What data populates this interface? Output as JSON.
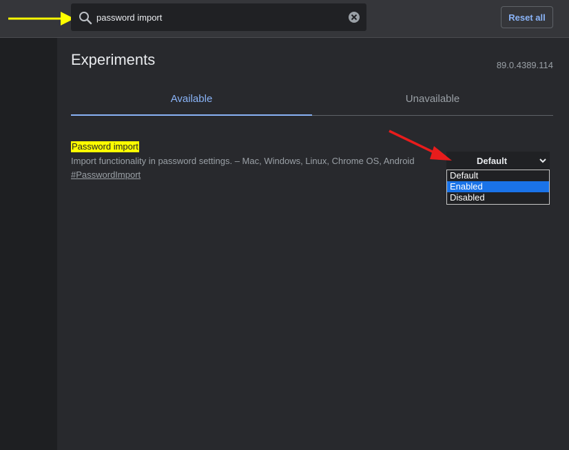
{
  "search": {
    "value": "password import"
  },
  "toolbar": {
    "reset_label": "Reset all"
  },
  "page": {
    "title": "Experiments",
    "version": "89.0.4389.114"
  },
  "tabs": [
    {
      "label": "Available",
      "active": true
    },
    {
      "label": "Unavailable",
      "active": false
    }
  ],
  "experiment": {
    "title": "Password import",
    "description": "Import functionality in password settings. – Mac, Windows, Linux, Chrome OS, Android",
    "link": "#PasswordImport",
    "selected_value": "Default",
    "options": [
      "Default",
      "Enabled",
      "Disabled"
    ],
    "highlighted_option": "Enabled"
  },
  "colors": {
    "accent": "#8ab4f8",
    "highlight": "#ffff00",
    "option_highlight": "#1a73e8",
    "annotation_yellow_arrow": "#ffff00",
    "annotation_red_arrow": "#e81c1c"
  }
}
